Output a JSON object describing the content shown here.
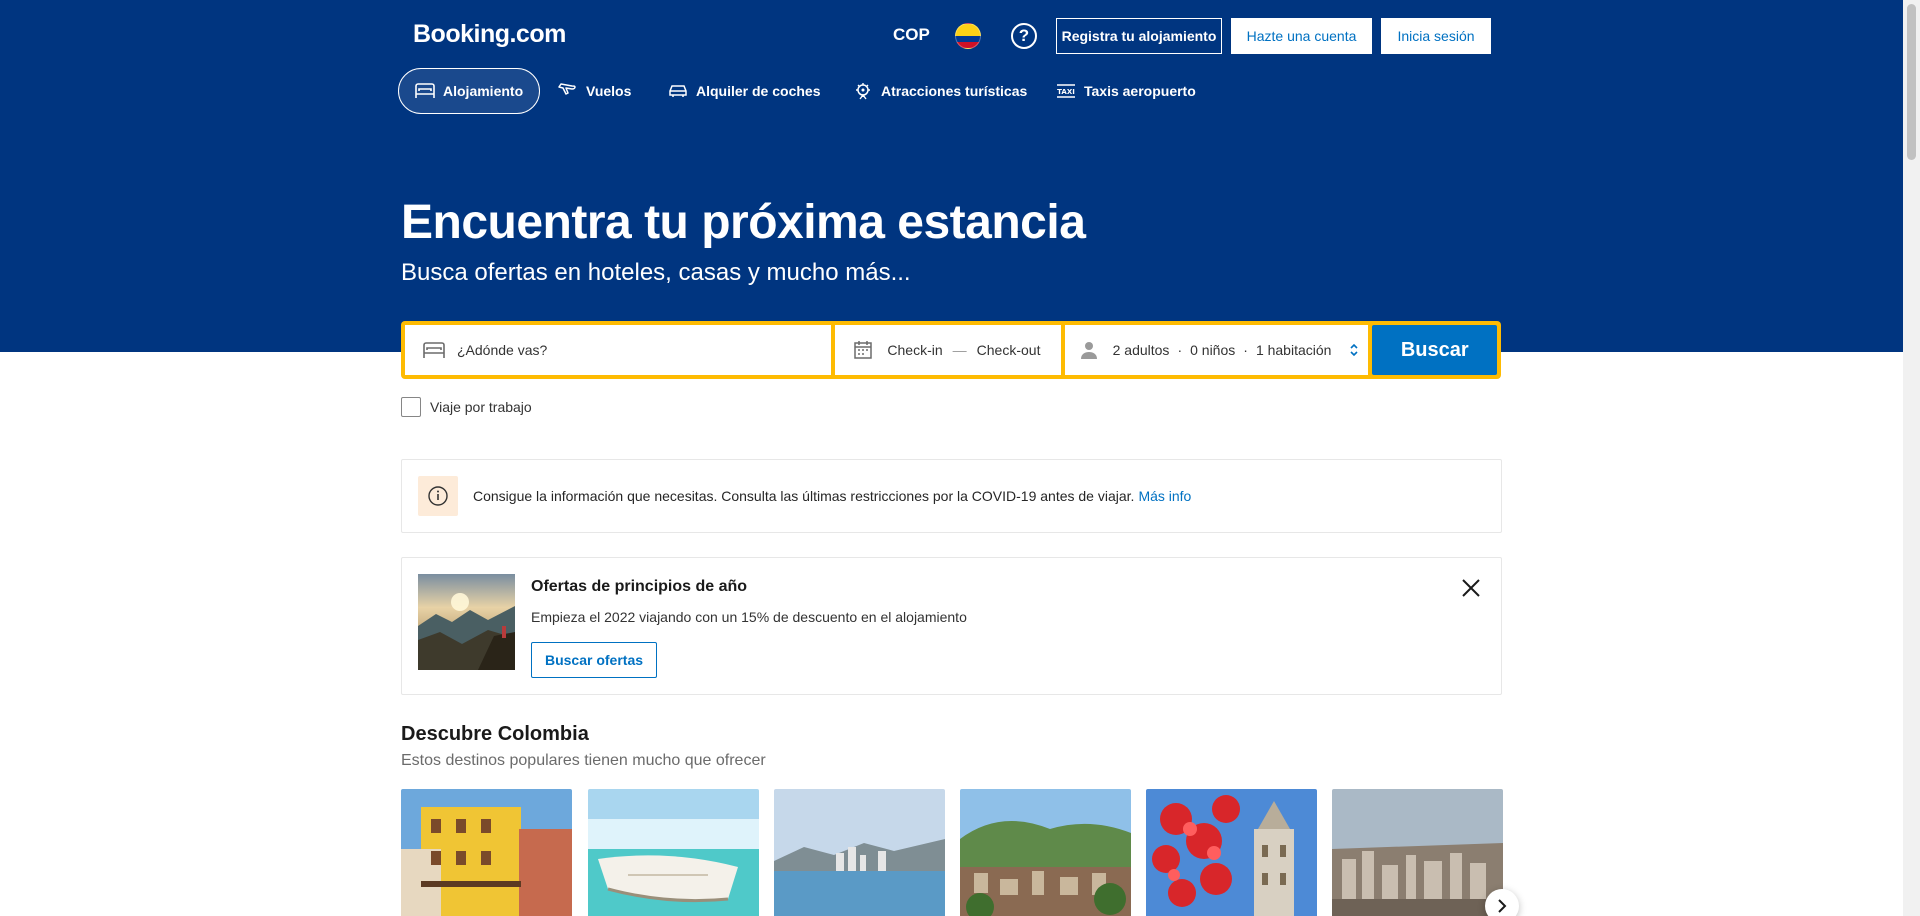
{
  "header": {
    "logo": "Booking.com",
    "currency": "COP",
    "help": "?",
    "register_label": "Registra tu alojamiento",
    "signup_label": "Hazte una cuenta",
    "login_label": "Inicia sesión"
  },
  "nav": {
    "items": [
      {
        "label": "Alojamiento",
        "icon": "bed-icon",
        "active": true
      },
      {
        "label": "Vuelos",
        "icon": "plane-icon",
        "active": false
      },
      {
        "label": "Alquiler de coches",
        "icon": "car-icon",
        "active": false
      },
      {
        "label": "Atracciones turísticas",
        "icon": "attraction-icon",
        "active": false
      },
      {
        "label": "Taxis aeropuerto",
        "icon": "taxi-icon",
        "active": false
      }
    ]
  },
  "hero": {
    "title": "Encuentra tu próxima estancia",
    "subtitle": "Busca ofertas en hoteles, casas y mucho más..."
  },
  "search": {
    "destination_placeholder": "¿Adónde vas?",
    "checkin": "Check-in",
    "dash": "—",
    "checkout": "Check-out",
    "adults": "2 adultos",
    "children": "0 niños",
    "rooms": "1 habitación",
    "dot": "·",
    "button": "Buscar",
    "work_trip": "Viaje por trabajo"
  },
  "covid": {
    "text": "Consigue la información que necesitas. Consulta las últimas restricciones por la COVID-19 antes de viajar.",
    "link": "Más info"
  },
  "offer": {
    "title": "Ofertas de principios de año",
    "description": "Empieza el 2022 viajando con un 15% de descuento en el alojamiento",
    "button": "Buscar ofertas"
  },
  "discover": {
    "title": "Descubre Colombia",
    "subtitle": "Estos destinos populares tienen mucho que ofrecer"
  },
  "colors": {
    "brand": "#003580",
    "accent": "#0071c2",
    "search_border": "#febb02"
  }
}
